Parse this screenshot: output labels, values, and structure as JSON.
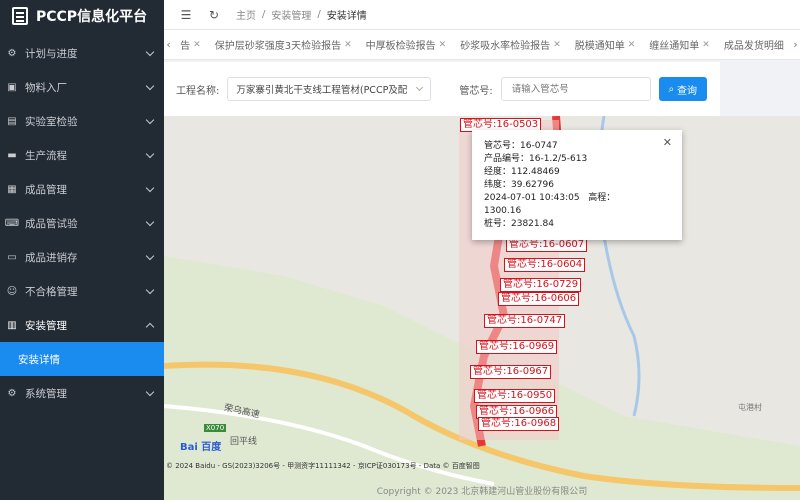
{
  "app": {
    "title": "PCCP信息化平台"
  },
  "sidebar": {
    "items": [
      {
        "label": "计划与进度",
        "icon": "gear-icon"
      },
      {
        "label": "物料入厂",
        "icon": "box-icon"
      },
      {
        "label": "实验室检验",
        "icon": "flask-icon"
      },
      {
        "label": "生产流程",
        "icon": "folder-icon"
      },
      {
        "label": "成品管理",
        "icon": "grid-icon"
      },
      {
        "label": "成品管试验",
        "icon": "keyboard-icon"
      },
      {
        "label": "成品进销存",
        "icon": "store-icon"
      },
      {
        "label": "不合格管理",
        "icon": "smile-icon"
      },
      {
        "label": "安装管理",
        "icon": "printer-icon"
      },
      {
        "label": "安装详情",
        "icon": ""
      },
      {
        "label": "系统管理",
        "icon": "cog-icon"
      }
    ]
  },
  "topbar": {
    "breadcrumb": [
      "主页",
      "安装管理",
      "安装详情"
    ]
  },
  "tabs": [
    "告",
    "保护层砂浆强度3天检验报告",
    "中厚板检验报告",
    "砂浆吸水率检验报告",
    "脱模通知单",
    "缠丝通知单",
    "成品发货明细"
  ],
  "filter": {
    "project_label": "工程名称:",
    "project_value": "万家寨引黄北干支线工程管材(PCCP及配",
    "core_label": "管芯号:",
    "core_placeholder": "请输入管芯号",
    "search_label": "查询"
  },
  "markers": [
    "管芯号:16-0503",
    "管芯号:16-0607",
    "管芯号:16-0604",
    "管芯号:16-0729",
    "管芯号:16-0606",
    "管芯号:16-0747",
    "管芯号:16-0969",
    "管芯号:16-0967",
    "管芯号:16-0950",
    "管芯号:16-0966",
    "管芯号:16-0968"
  ],
  "popup": {
    "core": "管芯号：16-0747",
    "product": "产品编号：16-1.2/5-613",
    "lng": "经度：112.48469",
    "lat": "纬度：39.62796",
    "time": "2024-07-01 10:43:05",
    "elev_label": "高程：",
    "elev": "1300.16",
    "pile": "桩号：23821.84"
  },
  "map": {
    "road1": "荣乌高速",
    "road2": "回平线",
    "road_code": "X070",
    "village": "屯港村",
    "baidu": "Bai 百度",
    "copyright": "© 2024 Baidu - GS(2023)3206号 - 甲测资字11111342 - 京ICP证030173号 - Data © 百度智图"
  },
  "footer": "Copyright © 2023 北京韩建河山管业股份有限公司"
}
